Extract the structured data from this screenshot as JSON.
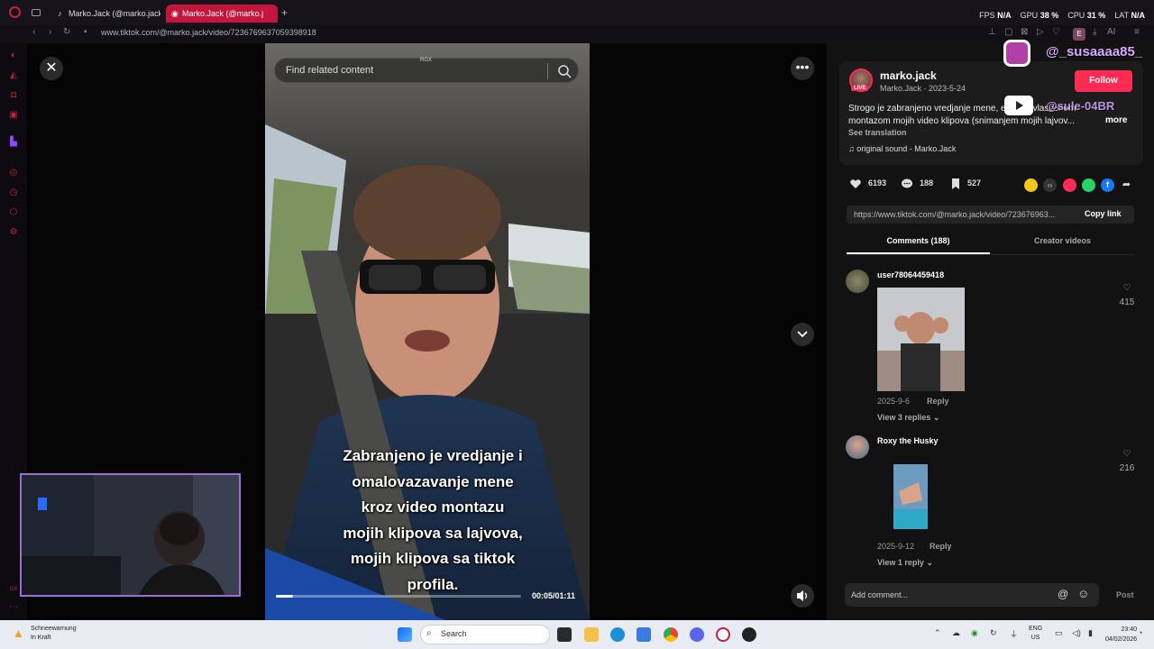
{
  "browser": {
    "tabs": [
      {
        "label": "Marko.Jack (@marko.jack"
      },
      {
        "label": "Marko.Jack (@marko.j"
      }
    ],
    "new_tab": "+",
    "url_host": "www.tiktok.com",
    "url_path": "/@marko.jack/video/7236769637059398918",
    "stats": {
      "fps_label": "FPS",
      "fps": "N/A",
      "gpu_label": "GPU",
      "gpu": "38 %",
      "cpu_label": "CPU",
      "cpu": "31 %",
      "lat_label": "LAT",
      "lat": "N/A"
    }
  },
  "video": {
    "search_placeholder": "Find related content",
    "rgx_label": "RGX",
    "caption": "Zabranjeno je vredjanje i\nomalovazavanje mene\nkroz video montazu\nmojih klipova sa lajvova,\nmojih klipova sa tiktok\nprofila.",
    "time": "00:05/01:11",
    "progress": 0.07
  },
  "overlay": {
    "instagram_handle": "@_susaaaa85_",
    "youtube_handle": "@sule-04BR"
  },
  "post": {
    "username": "marko.jack",
    "live_badge": "LIVE",
    "subtitle": "Marko.Jack · 2023-5-24",
    "follow_label": "Follow",
    "description": "Strogo je zabranjeno vredjanje mene, etc, neovlascenom montazom mojih video klipova (snimanjem mojih lajvov...",
    "more_label": "more",
    "see_translation": "See translation",
    "sound": "original sound - Marko.Jack",
    "likes": "6193",
    "comments": "188",
    "saves": "527",
    "link": "https://www.tiktok.com/@marko.jack/video/723676963...",
    "copy_link": "Copy link",
    "tab_comments": "Comments (188)",
    "tab_creator": "Creator videos"
  },
  "comments": [
    {
      "user": "user78064459418",
      "date": "2025-9-6",
      "reply": "Reply",
      "view_replies": "View 3 replies",
      "likes": "415"
    },
    {
      "user": "Roxy the Husky",
      "date": "2025-9-12",
      "reply": "Reply",
      "view_replies": "View 1 reply",
      "likes": "216"
    }
  ],
  "composer": {
    "placeholder": "Add comment...",
    "post_label": "Post"
  },
  "taskbar": {
    "weather_line1": "Schneewarnung",
    "weather_line2": "In Kraft",
    "search_label": "Search",
    "lang_line1": "ENG",
    "lang_line2": "US",
    "time": "23:40",
    "date": "04/02/2026"
  },
  "colors": {
    "accent": "#fe2c55",
    "tab_active": "#c4153c",
    "webcam_border": "#9a6fd0"
  }
}
